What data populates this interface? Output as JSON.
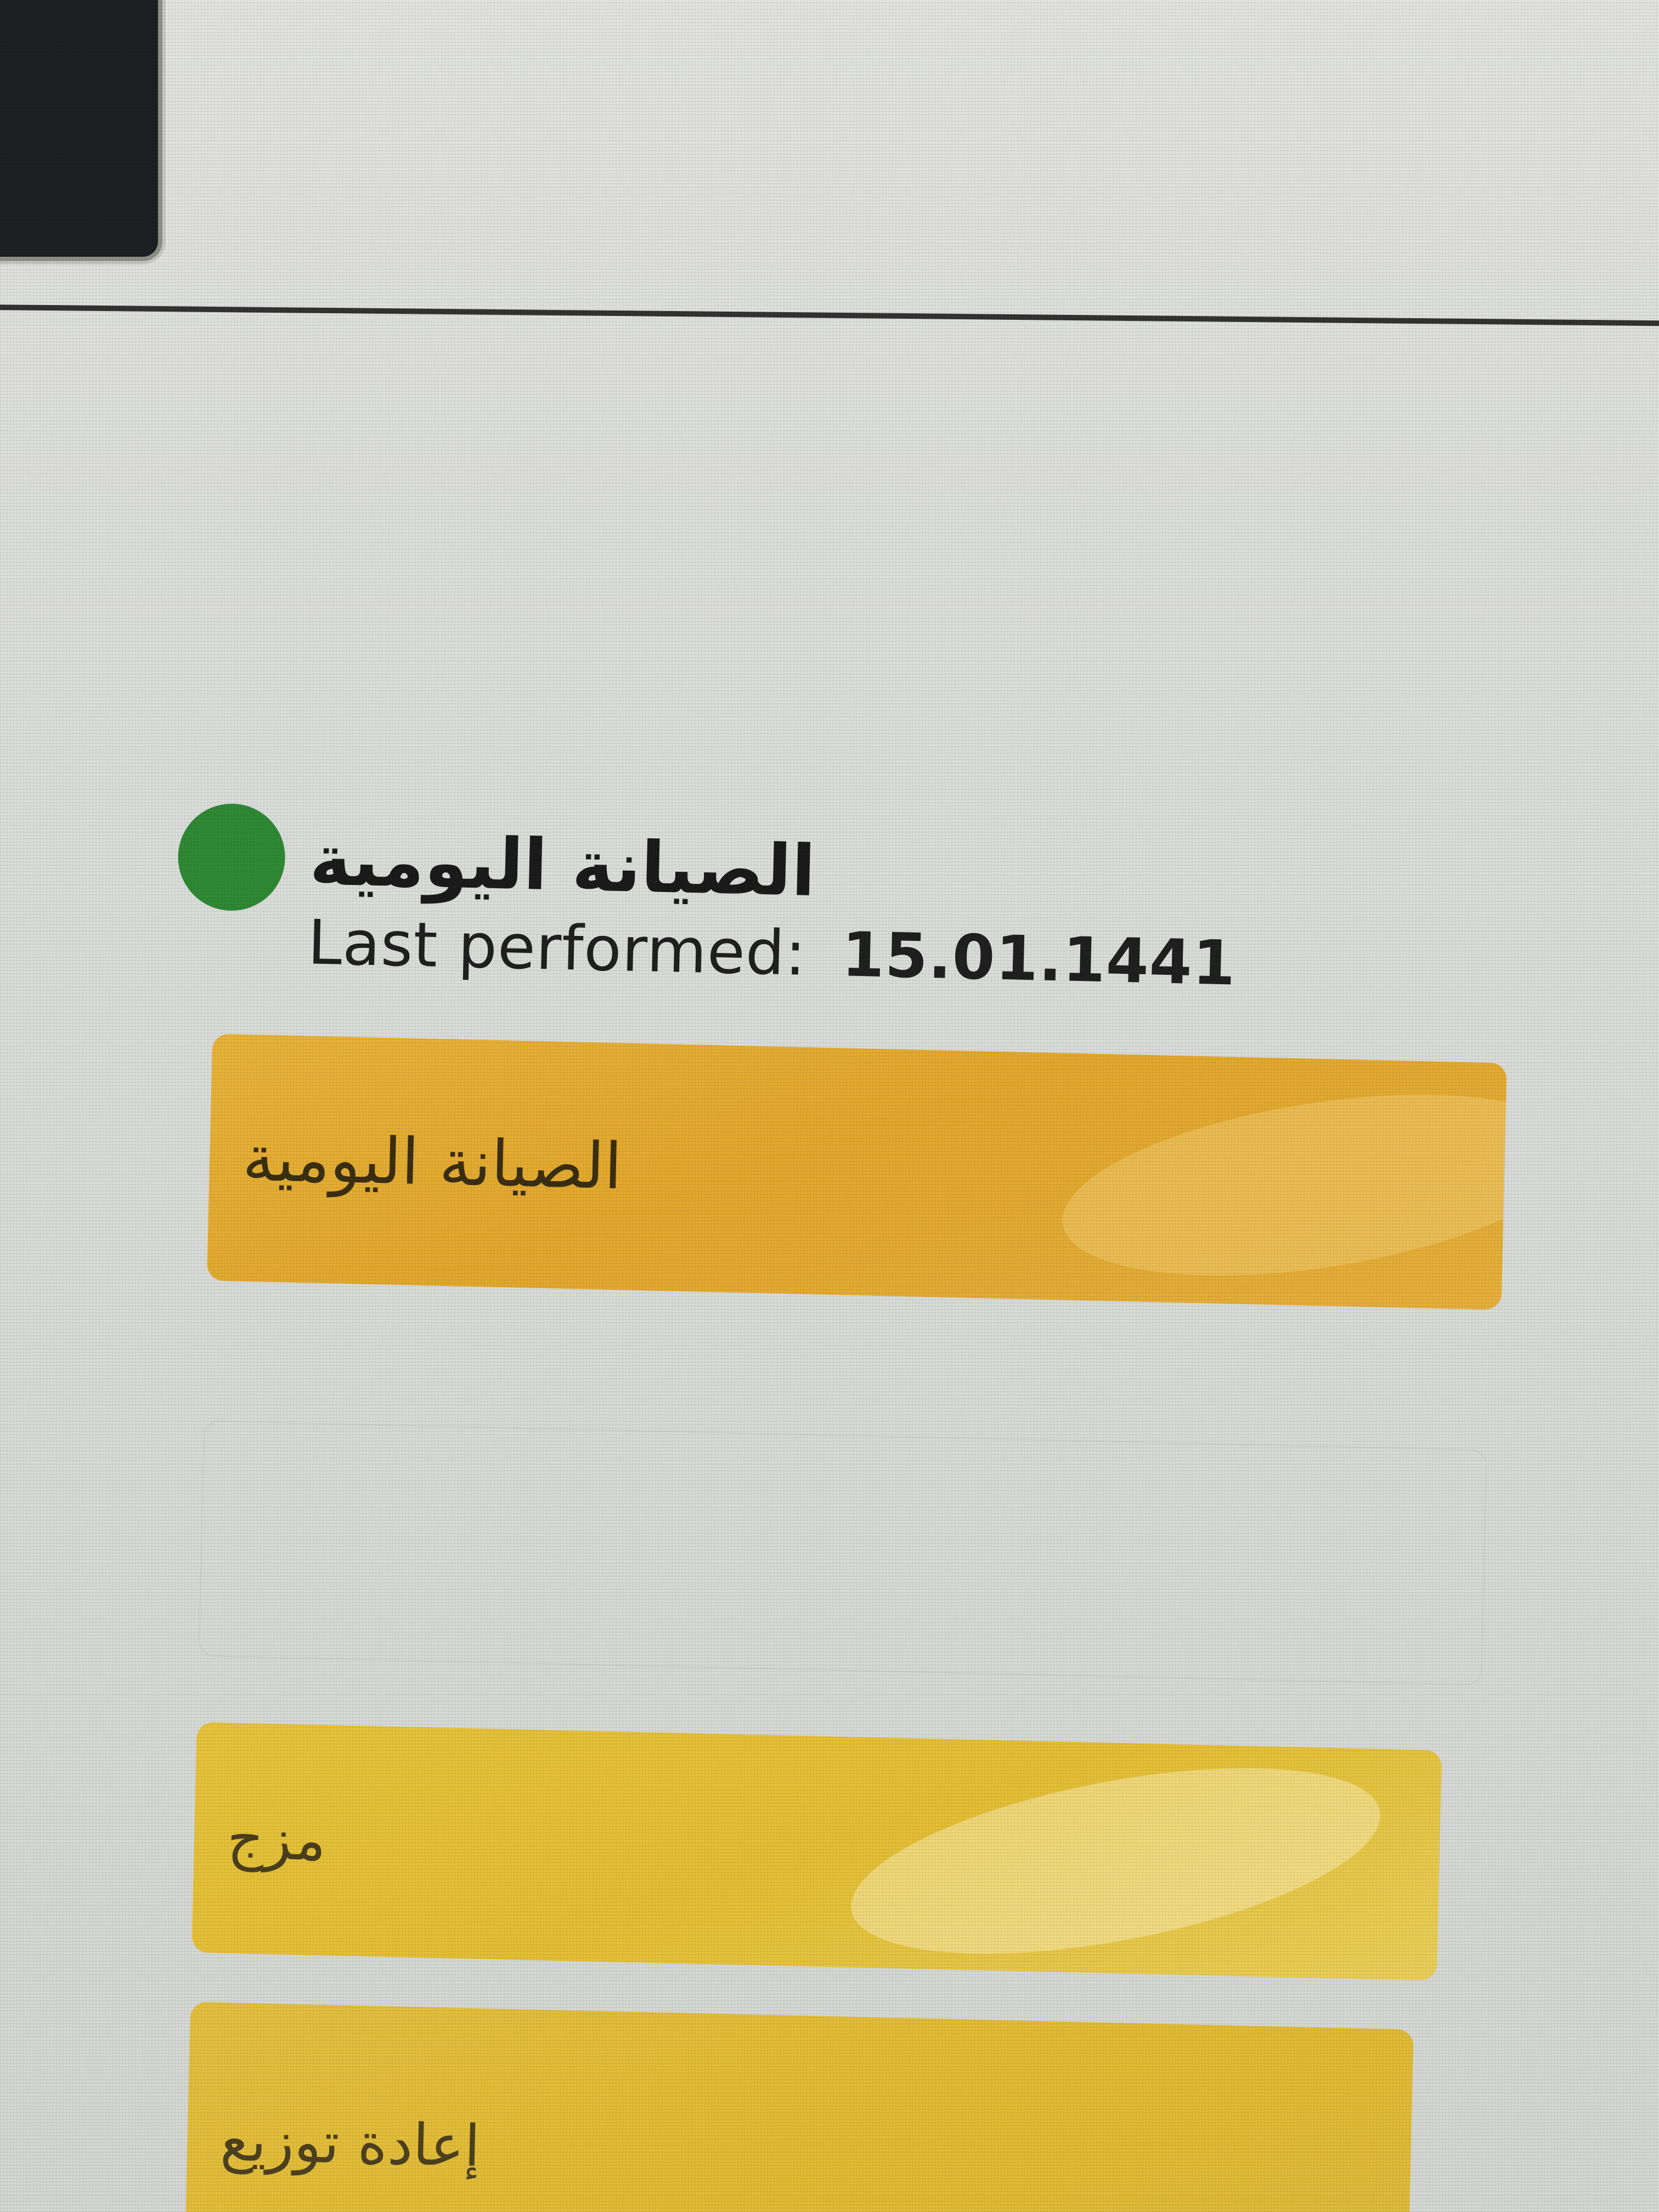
{
  "task": {
    "title": "الصيانة اليومية",
    "last_performed_label": "Last performed:",
    "last_performed_value": "15.01.1441",
    "status_color": "#2f8a35"
  },
  "actions": {
    "primary_label": "الصيانة اليومية",
    "disabled_label": "",
    "merge_label": "مزج",
    "redistribute_label": "إعادة توزيع"
  },
  "colors": {
    "primary_button": "#e3a92d",
    "merge_button": "#e5bf34",
    "redistribute_button": "#e3bc35",
    "top_panel": "#1d1f22"
  }
}
